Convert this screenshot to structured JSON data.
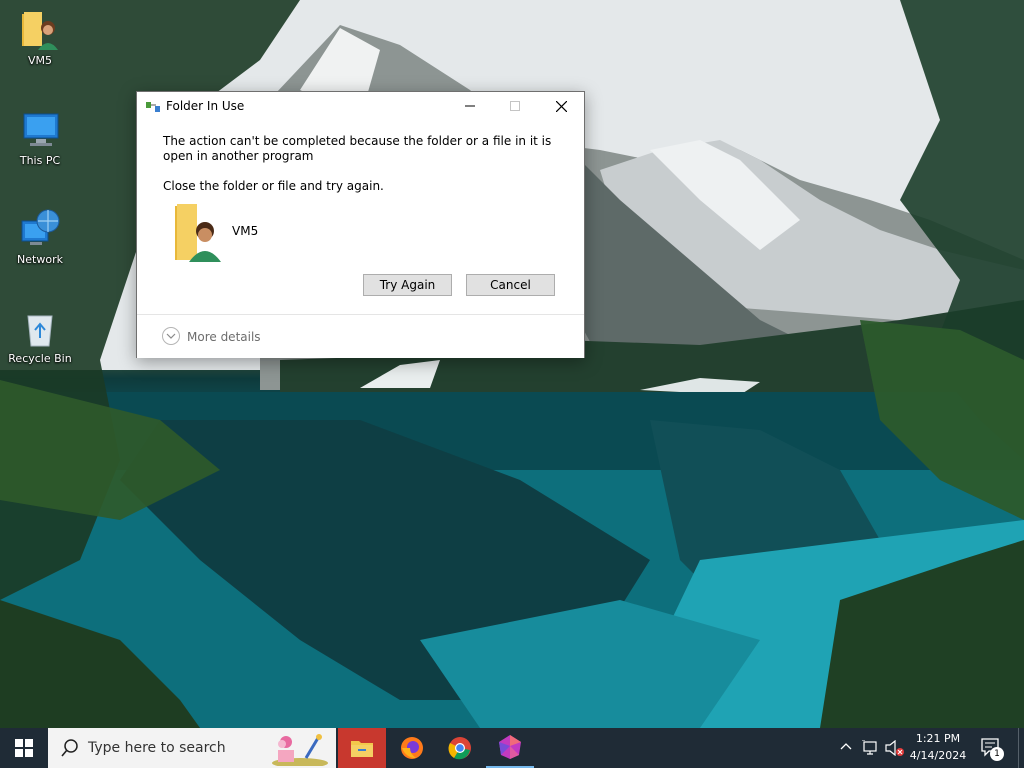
{
  "desktop": {
    "icons": [
      {
        "label": "VM5"
      },
      {
        "label": "This PC"
      },
      {
        "label": "Network"
      },
      {
        "label": "Recycle Bin"
      }
    ]
  },
  "dialog": {
    "title": "Folder In Use",
    "message": "The action can't be completed because the folder or a file in it is open in another program",
    "instruction": "Close the folder or file and try again.",
    "item_name": "VM5",
    "try_again_label": "Try Again",
    "cancel_label": "Cancel",
    "more_details_label": "More details"
  },
  "taskbar": {
    "search_placeholder": "Type here to search",
    "apps": [
      "file-explorer",
      "firefox",
      "chrome",
      "app"
    ],
    "time": "1:21 PM",
    "date": "4/14/2024",
    "notification_count": "1"
  },
  "colors": {
    "taskbar_bg": "#1f2b36",
    "button_bg": "#e1e1e1",
    "folder_yellow": "#f3c84b"
  }
}
